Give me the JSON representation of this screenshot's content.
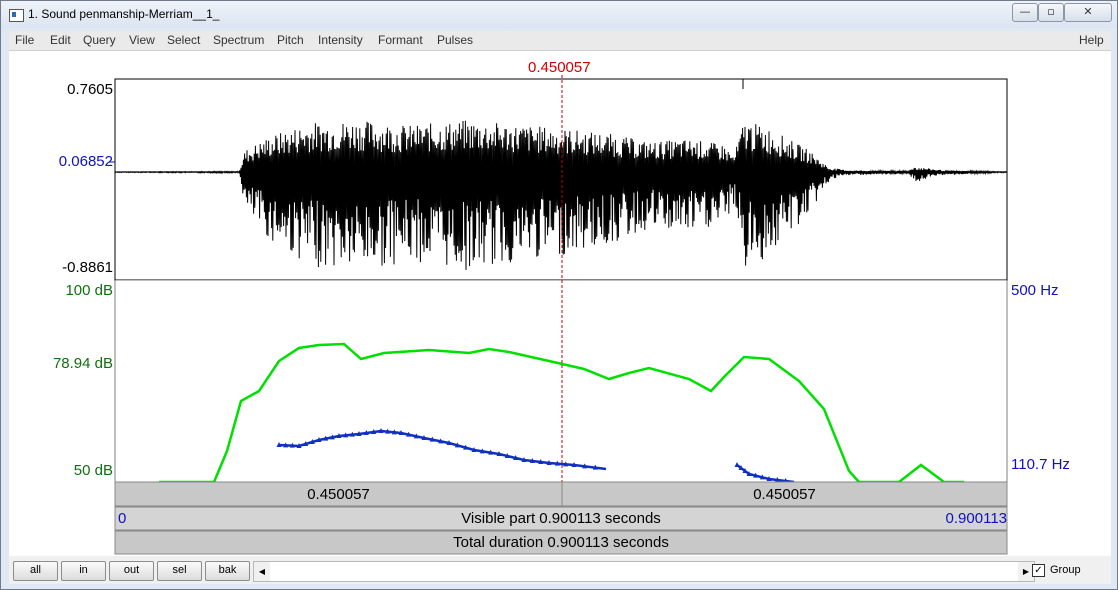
{
  "window": {
    "title": "1. Sound penmanship-Merriam__1_",
    "controls": {
      "minimize": "—",
      "maximize": "▫",
      "close": "✕"
    }
  },
  "menu": [
    "File",
    "Edit",
    "Query",
    "View",
    "Select",
    "Spectrum",
    "Pitch",
    "Intensity",
    "Formant",
    "Pulses"
  ],
  "help_label": "Help",
  "cursor": {
    "time_label": "0.450057",
    "time": 0.450057
  },
  "waveform": {
    "max_label": "0.7605",
    "zero_label": "0.06852",
    "min_label": "-0.8861"
  },
  "intensity": {
    "top_label": "100 dB",
    "mid_label": "78.94 dB",
    "bottom_label": "50 dB",
    "color": "#00e000"
  },
  "pitch": {
    "top_label": "500 Hz",
    "bottom_label": "110.7 Hz",
    "color": "#1030c0"
  },
  "bars": {
    "left_segment": "0.450057",
    "right_segment": "0.450057",
    "start": "0",
    "visible_part": "Visible part 0.900113 seconds",
    "end": "0.900113",
    "total_duration": "Total duration 0.900113 seconds"
  },
  "buttons": {
    "all": "all",
    "in": "in",
    "out": "out",
    "sel": "sel",
    "bak": "bak"
  },
  "scrollbar": {
    "left_arrow": "◀",
    "right_arrow": "▶"
  },
  "group": {
    "label": "Group",
    "checked": true,
    "check_mark": "✓"
  }
}
